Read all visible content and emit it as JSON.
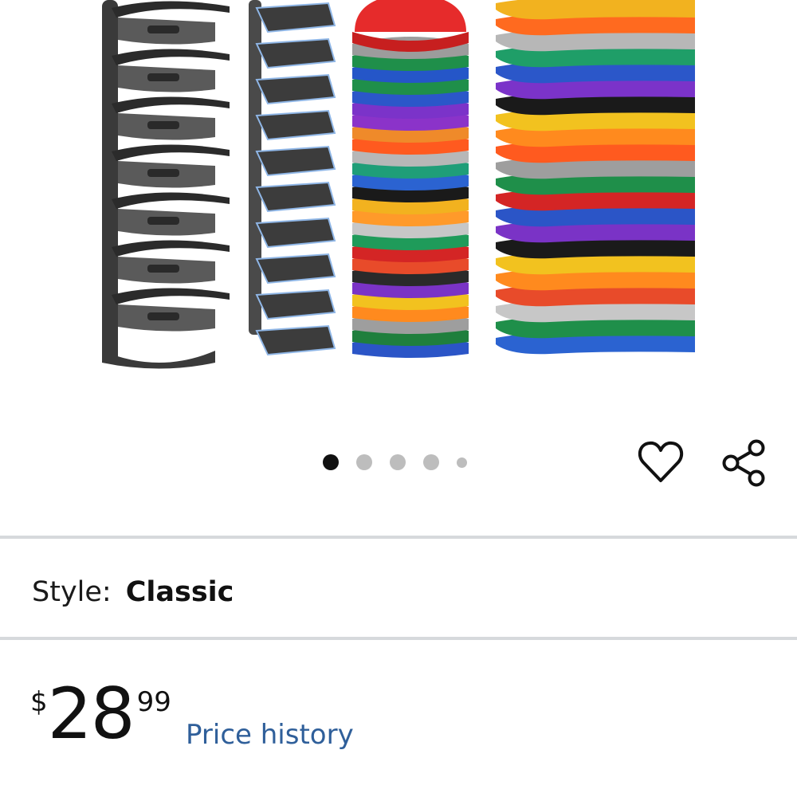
{
  "gallery": {
    "image_count": 5,
    "active_index": 0
  },
  "actions": {
    "favorite_icon": "heart-outline-icon",
    "share_icon": "share-icon"
  },
  "style": {
    "label": "Style:",
    "value": "Classic"
  },
  "price": {
    "currency": "$",
    "whole": "28",
    "cents": "99",
    "history_link": "Price history"
  },
  "colors": {
    "divider": "#d6d9dc",
    "link": "#2f5f9a",
    "dot_active": "#111111",
    "dot_inactive": "#bdbdbd"
  }
}
